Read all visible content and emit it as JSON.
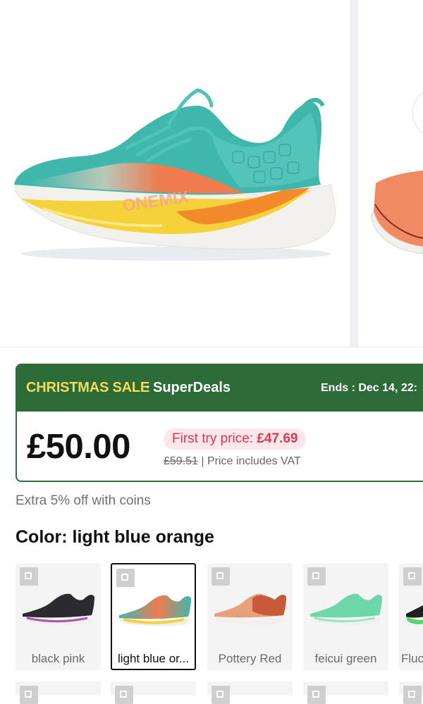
{
  "gallery": {
    "main_image_alt": "light blue orange running shoe",
    "brand_mark": "ONEMIX",
    "colors": {
      "upper": "#3fb7ad",
      "midfoot": "#ef7b4f",
      "sole": "#f3f1ec",
      "flame_yellow": "#f5d23a",
      "flame_orange": "#f28a2c"
    }
  },
  "sale": {
    "name": "CHRISTMAS SALE",
    "separator": "·",
    "subtitle": "SuperDeals",
    "ends": "Ends : Dec 14, 22:",
    "colors": {
      "header_bg": "#2d6b38",
      "name": "#f7d85b",
      "accent": "#e0364f"
    }
  },
  "price": {
    "current": "£50.00",
    "first_try_label": "First try price:",
    "first_try_value": "£47.69",
    "original": "£59.51",
    "divider": "|",
    "vat_note": "Price includes VAT"
  },
  "extra_offer": "Extra 5% off with coins",
  "color_selector": {
    "title": "Color: light blue orange",
    "options": [
      {
        "label": "black pink",
        "selected": false,
        "colors": {
          "upper": "#2b2b2f",
          "accent": "#b24fb6"
        }
      },
      {
        "label": "light blue or...",
        "selected": true,
        "colors": {
          "upper": "#3fb7ad",
          "accent": "#ef7b4f"
        }
      },
      {
        "label": "Pottery Red",
        "selected": false,
        "colors": {
          "upper": "#c85a39",
          "accent": "#e8a07c"
        }
      },
      {
        "label": "feicui green",
        "selected": false,
        "colors": {
          "upper": "#6ed7a9",
          "accent": "#9be6c3"
        }
      },
      {
        "label": "Fluo",
        "selected": false,
        "colors": {
          "upper": "#1f1f1f",
          "accent": "#56d86b"
        }
      }
    ]
  }
}
